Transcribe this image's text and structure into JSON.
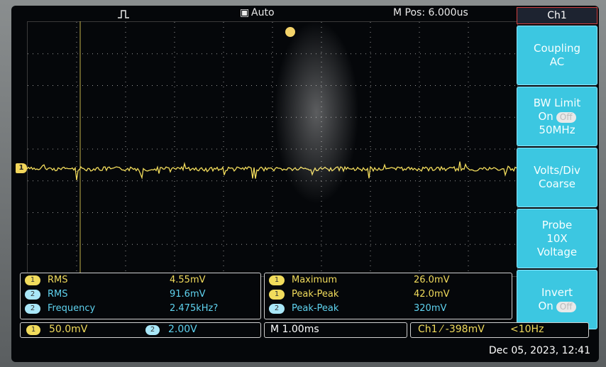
{
  "status": {
    "trigger_mode": "Auto",
    "mpos": "M Pos: 6.000us"
  },
  "channel_marker": "1",
  "menu": {
    "title": "Ch1",
    "coupling": {
      "label": "Coupling",
      "value": "AC"
    },
    "bw_limit": {
      "label": "BW Limit",
      "on": "On",
      "off": "Off",
      "value": "50MHz"
    },
    "volts_div": {
      "label": "Volts/Div",
      "value": "Coarse"
    },
    "probe": {
      "label": "Probe",
      "value": "10X",
      "type": "Voltage"
    },
    "invert": {
      "label": "Invert",
      "on": "On",
      "off": "Off"
    }
  },
  "measurements_left": [
    {
      "ch": "1",
      "name": "RMS",
      "value": "4.55mV",
      "color": "#f2dc5c"
    },
    {
      "ch": "2",
      "name": "RMS",
      "value": "91.6mV",
      "color": "#5fd3f0"
    },
    {
      "ch": "2",
      "name": "Frequency",
      "value": "2.475kHz?",
      "color": "#5fd3f0"
    }
  ],
  "measurements_right": [
    {
      "ch": "1",
      "name": "Maximum",
      "value": "26.0mV",
      "color": "#f2dc5c"
    },
    {
      "ch": "1",
      "name": "Peak-Peak",
      "value": "42.0mV",
      "color": "#f2dc5c"
    },
    {
      "ch": "2",
      "name": "Peak-Peak",
      "value": "320mV",
      "color": "#5fd3f0"
    }
  ],
  "scale": {
    "ch1_badge": "1",
    "ch1_scale": "50.0mV",
    "ch2_badge": "2",
    "ch2_scale": "2.00V",
    "timebase": "M 1.00ms",
    "trigger": "Ch1 ⁄ -398mV",
    "trigger_freq": "<10Hz"
  },
  "datetime": "Dec 05, 2023, 12:41",
  "colors": {
    "ch1": "#f2dc5c",
    "ch2": "#5fd3f0",
    "menu": "#3cc7e1"
  }
}
